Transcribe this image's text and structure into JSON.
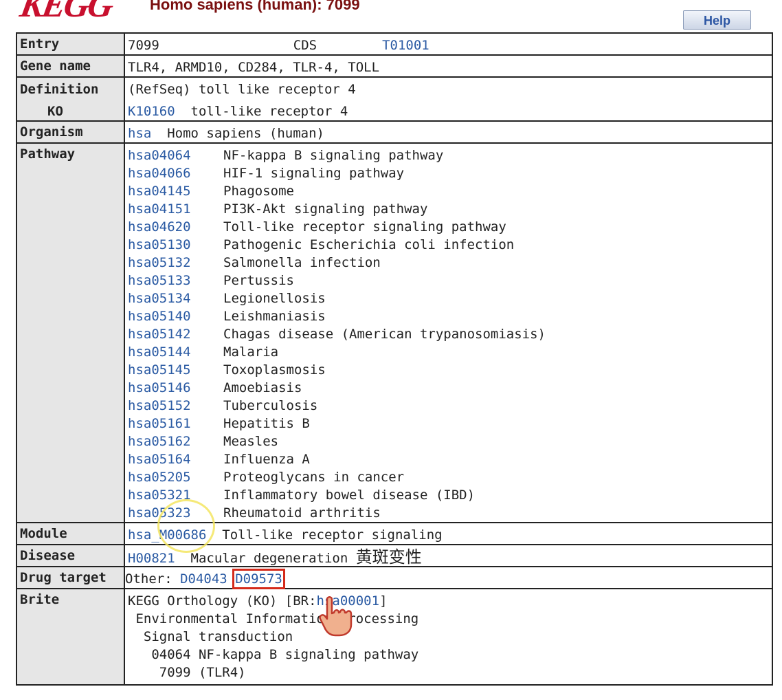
{
  "header": {
    "logo_text": "KEGG",
    "title": "Homo sapiens (human): 7099",
    "help_label": "Help"
  },
  "rows": {
    "entry": {
      "label": "Entry",
      "id": "7099",
      "type": "CDS",
      "genome_link": "T01001"
    },
    "gene_name": {
      "label": "Gene name",
      "value": "TLR4, ARMD10, CD284, TLR-4, TOLL"
    },
    "definition": {
      "label": "Definition",
      "value": "(RefSeq) toll like receptor 4"
    },
    "ko": {
      "label": "KO",
      "id": "K10160",
      "desc": "toll-like receptor 4"
    },
    "organism": {
      "label": "Organism",
      "code": "hsa",
      "name": "Homo sapiens (human)"
    },
    "pathway": {
      "label": "Pathway",
      "items": [
        {
          "id": "hsa04064",
          "name": "NF-kappa B signaling pathway"
        },
        {
          "id": "hsa04066",
          "name": "HIF-1 signaling pathway"
        },
        {
          "id": "hsa04145",
          "name": "Phagosome"
        },
        {
          "id": "hsa04151",
          "name": "PI3K-Akt signaling pathway"
        },
        {
          "id": "hsa04620",
          "name": "Toll-like receptor signaling pathway"
        },
        {
          "id": "hsa05130",
          "name": "Pathogenic Escherichia coli infection"
        },
        {
          "id": "hsa05132",
          "name": "Salmonella infection"
        },
        {
          "id": "hsa05133",
          "name": "Pertussis"
        },
        {
          "id": "hsa05134",
          "name": "Legionellosis"
        },
        {
          "id": "hsa05140",
          "name": "Leishmaniasis"
        },
        {
          "id": "hsa05142",
          "name": "Chagas disease (American trypanosomiasis)"
        },
        {
          "id": "hsa05144",
          "name": "Malaria"
        },
        {
          "id": "hsa05145",
          "name": "Toxoplasmosis"
        },
        {
          "id": "hsa05146",
          "name": "Amoebiasis"
        },
        {
          "id": "hsa05152",
          "name": "Tuberculosis"
        },
        {
          "id": "hsa05161",
          "name": "Hepatitis B"
        },
        {
          "id": "hsa05162",
          "name": "Measles"
        },
        {
          "id": "hsa05164",
          "name": "Influenza A"
        },
        {
          "id": "hsa05205",
          "name": "Proteoglycans in cancer"
        },
        {
          "id": "hsa05321",
          "name": "Inflammatory bowel disease (IBD)"
        },
        {
          "id": "hsa05323",
          "name": "Rheumatoid arthritis"
        }
      ]
    },
    "module": {
      "label": "Module",
      "id": "hsa_M00686",
      "name": "Toll-like receptor signaling"
    },
    "disease": {
      "label": "Disease",
      "id": "H00821",
      "name": "Macular degeneration",
      "note_cjk": "黄斑变性"
    },
    "drug_target": {
      "label": "Drug target",
      "prefix": "Other:",
      "drug1": "D04043",
      "drug2": "D09573"
    },
    "brite": {
      "label": "Brite",
      "line1_prefix": "KEGG Orthology (KO) [BR:",
      "line1_link": "hsa00001",
      "line1_suffix": "]",
      "lines": [
        " Environmental Information Processing",
        "  Signal transduction",
        "   04064 NF-kappa B signaling pathway",
        "    7099 (TLR4)"
      ]
    }
  },
  "colors": {
    "link": "#2a5aa3",
    "label_bg": "#e6e6e6",
    "title": "#7a1010",
    "logo": "#c8102e",
    "highlight": "#d42a1a"
  }
}
